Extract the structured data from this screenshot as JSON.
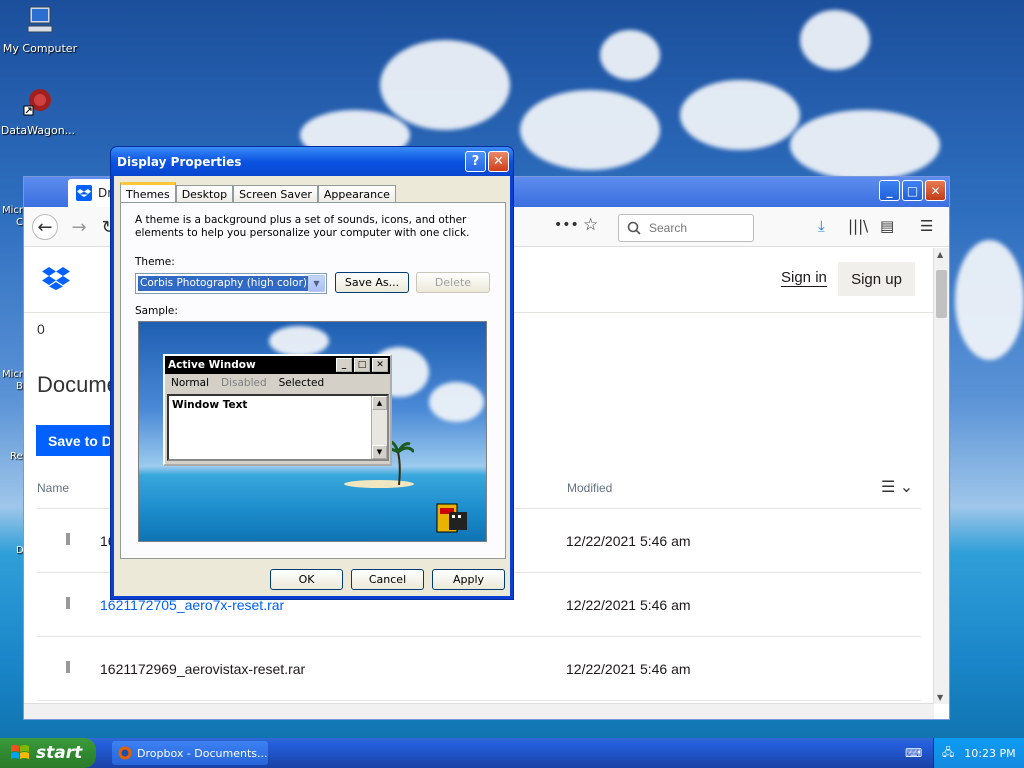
{
  "desktop": {
    "icons": [
      {
        "label": "My Computer"
      },
      {
        "label": "DataWagon..."
      }
    ],
    "edge_labels": [
      "Micr",
      "C",
      "Micr",
      "B",
      "Re",
      "D"
    ]
  },
  "firefox": {
    "tab_title": "Dro",
    "search_placeholder": "Search",
    "sign_in": "Sign in",
    "sign_up": "Sign up",
    "count": "0",
    "heading": "Docume",
    "save_button": "Save to D",
    "columns": {
      "name": "Name",
      "modified": "Modified"
    },
    "rows": [
      {
        "name": "16",
        "modified": "12/22/2021 5:46 am",
        "link": false
      },
      {
        "name": "1621172705_aero7x-reset.rar",
        "modified": "12/22/2021 5:46 am",
        "link": true
      },
      {
        "name": "1621172969_aerovistax-reset.rar",
        "modified": "12/22/2021 5:46 am",
        "link": false
      }
    ]
  },
  "dialog": {
    "title": "Display Properties",
    "help": "?",
    "tabs": [
      "Themes",
      "Desktop",
      "Screen Saver",
      "Appearance"
    ],
    "description": "A theme is a background plus a set of sounds, icons, and other elements to help you personalize your computer with one click.",
    "theme_label": "Theme:",
    "theme_value": "Corbis Photography (high color)",
    "save_as": "Save As...",
    "delete": "Delete",
    "sample_label": "Sample:",
    "sample": {
      "window_title": "Active Window",
      "menu": [
        "Normal",
        "Disabled",
        "Selected"
      ],
      "window_text": "Window Text"
    },
    "ok": "OK",
    "cancel": "Cancel",
    "apply": "Apply"
  },
  "taskbar": {
    "start": "start",
    "task": "Dropbox - Documents...",
    "clock": "10:23 PM"
  },
  "colors": {
    "accent": "#0061fe",
    "xp_blue": "#0a53e2",
    "start_green": "#2f8a2f"
  }
}
